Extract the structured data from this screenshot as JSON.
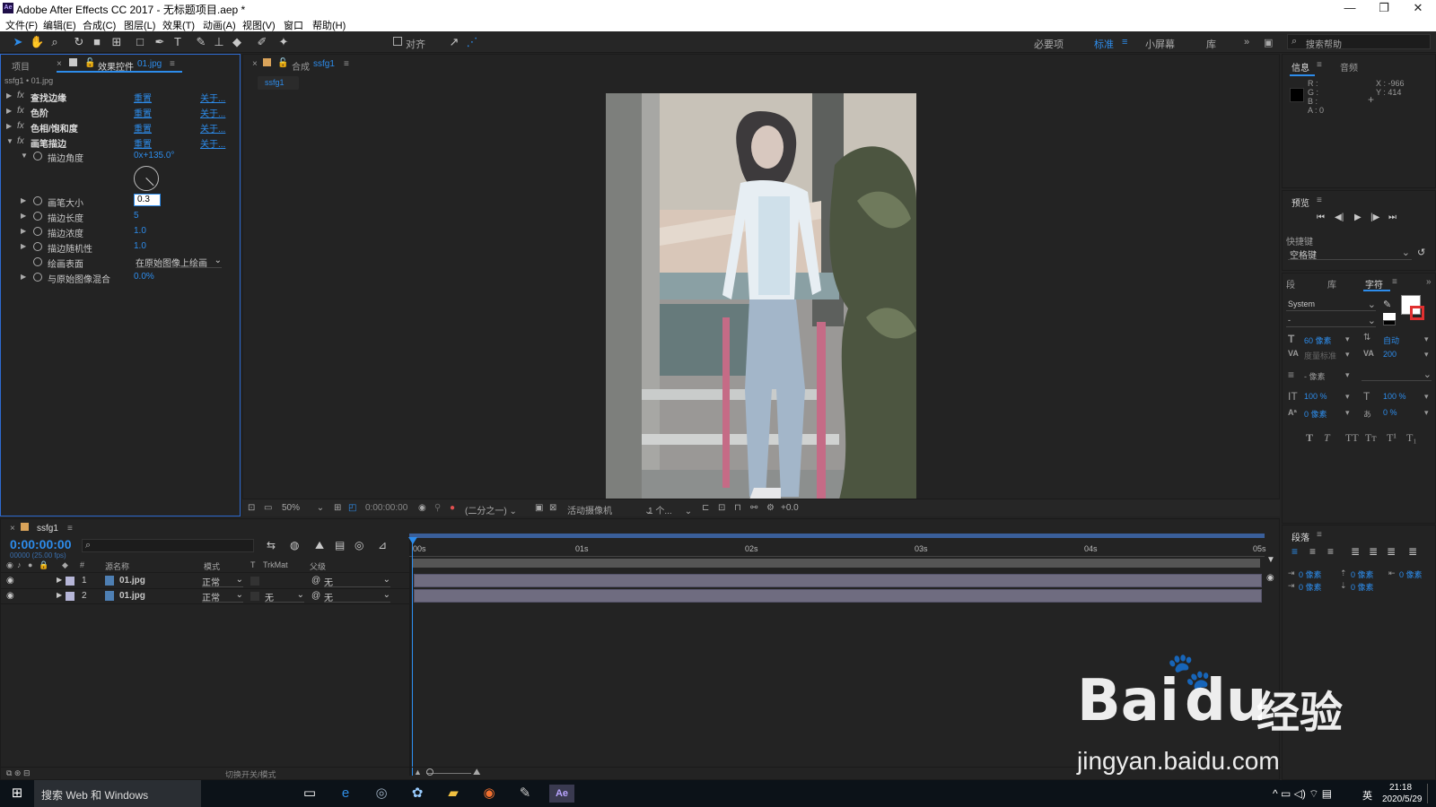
{
  "window": {
    "title": "Adobe After Effects CC 2017 - 无标题项目.aep *",
    "app_icon": "Ae"
  },
  "menu": [
    "文件(F)",
    "编辑(E)",
    "合成(C)",
    "图层(L)",
    "效果(T)",
    "动画(A)",
    "视图(V)",
    "窗口",
    "帮助(H)"
  ],
  "toolbar": {
    "align_label": "对齐",
    "workspaces": [
      "必要项",
      "标准",
      "小屏幕",
      "库"
    ],
    "active_workspace": "标准",
    "search_placeholder": "搜索帮助"
  },
  "project_panel": {
    "tab_project": "项目",
    "tab_effect_controls_prefix": "效果控件",
    "tab_effect_controls_file": "01.jpg",
    "breadcrumb": "ssfg1 • 01.jpg",
    "effects": [
      {
        "name": "查找边缘",
        "reset": "重置",
        "about": "关于..."
      },
      {
        "name": "色阶",
        "reset": "重置",
        "about": "关于..."
      },
      {
        "name": "色相/饱和度",
        "reset": "重置",
        "about": "关于..."
      },
      {
        "name": "画笔描边",
        "reset": "重置",
        "about": "关于..."
      }
    ],
    "brush_params": [
      {
        "name": "描边角度",
        "value": "0x+135.0°"
      },
      {
        "name": "画笔大小",
        "value": "0.3"
      },
      {
        "name": "描边长度",
        "value": "5"
      },
      {
        "name": "描边浓度",
        "value": "1.0"
      },
      {
        "name": "描边随机性",
        "value": "1.0"
      },
      {
        "name": "绘画表面",
        "value": "在原始图像上绘画"
      },
      {
        "name": "与原始图像混合",
        "value": "0.0%"
      }
    ]
  },
  "composition": {
    "tab_label": "合成",
    "comp_name": "ssfg1",
    "sub_tab": "ssfg1",
    "zoom": "50%",
    "timecode": "0:00:00:00",
    "resolution": "(二分之一)",
    "camera": "活动摄像机",
    "views": "1 个...",
    "exposure": "+0.0"
  },
  "right_panel": {
    "info_tab": "信息",
    "audio_tab": "音频",
    "info_r": "R :",
    "info_g": "G :",
    "info_b": "B :",
    "info_a": "A : 0",
    "info_x": "X : -966",
    "info_y": "Y : 414",
    "preview_tab": "预览",
    "shortcut_label": "快捷键",
    "shortcut_value": "空格键",
    "tabs": [
      "段",
      "库",
      "字符"
    ],
    "font": "System",
    "style": "-",
    "size": "60 像素",
    "leading": "自动",
    "kerning": "度量标准",
    "tracking": "200",
    "stroke": "- 像素",
    "vscale": "100 %",
    "hscale": "100 %",
    "baseline": "0 像素",
    "tsume": "0 %",
    "paragraph_tab": "段落",
    "indent_values": [
      "0 像素",
      "0 像素",
      "0 像素",
      "0 像素",
      "0 像素"
    ]
  },
  "timeline": {
    "tab": "ssfg1",
    "timecode": "0:00:00:00",
    "timecode_sub": "00000 (25.00 fps)",
    "headers": {
      "num": "#",
      "source": "源名称",
      "mode": "模式",
      "t": "T",
      "trkmat": "TrkMat",
      "parent": "父级"
    },
    "layers": [
      {
        "num": "1",
        "name": "01.jpg",
        "mode": "正常",
        "trkmat": "",
        "parent": "无"
      },
      {
        "num": "2",
        "name": "01.jpg",
        "mode": "正常",
        "trkmat": "无",
        "parent": "无"
      }
    ],
    "ruler": [
      "00s",
      "01s",
      "02s",
      "03s",
      "04s",
      "05s"
    ],
    "footer": "切换开关/模式"
  },
  "taskbar": {
    "search": "搜索 Web 和 Windows",
    "time": "21:18",
    "date": "2020/5/29",
    "ime": "英"
  },
  "watermark": {
    "brand": "Bai",
    "du": "du",
    "cn": "经验",
    "url": "jingyan.baidu.com"
  }
}
